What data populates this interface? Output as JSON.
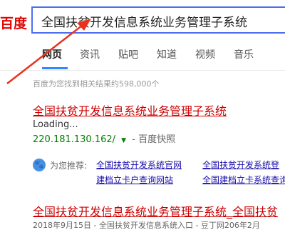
{
  "header": {
    "logo": "百度",
    "search_value": "全国扶贫开发信息系统业务管理子系统"
  },
  "tabs": [
    "网页",
    "资讯",
    "贴吧",
    "知道",
    "视频",
    "音乐"
  ],
  "results_count": "百度为您找到相关结果约598,000个",
  "result1": {
    "title": "全国扶贫开发信息系统业务管理子系统",
    "loading": "Loading...",
    "url": "220.181.130.162/",
    "caret": "▼",
    "separator": " - ",
    "snapshot": "百度快照"
  },
  "recommend": {
    "label": "为您推荐:",
    "links": [
      "全国扶贫开发系统官网",
      "全国扶贫开发系统登",
      "建档立卡户查询网站",
      "全国建档立卡系统查询"
    ]
  },
  "result2": {
    "title": "全国扶贫开发信息系统业务管理子系统_全国扶贫",
    "date_line": "2018年9月15日 - 全国扶贫开发信息系统入口 - 豆丁网206年2月"
  },
  "colors": {
    "accent": "#4e6ef2",
    "title_red": "#cc0000",
    "annotation_arrow": "#e8321e"
  }
}
